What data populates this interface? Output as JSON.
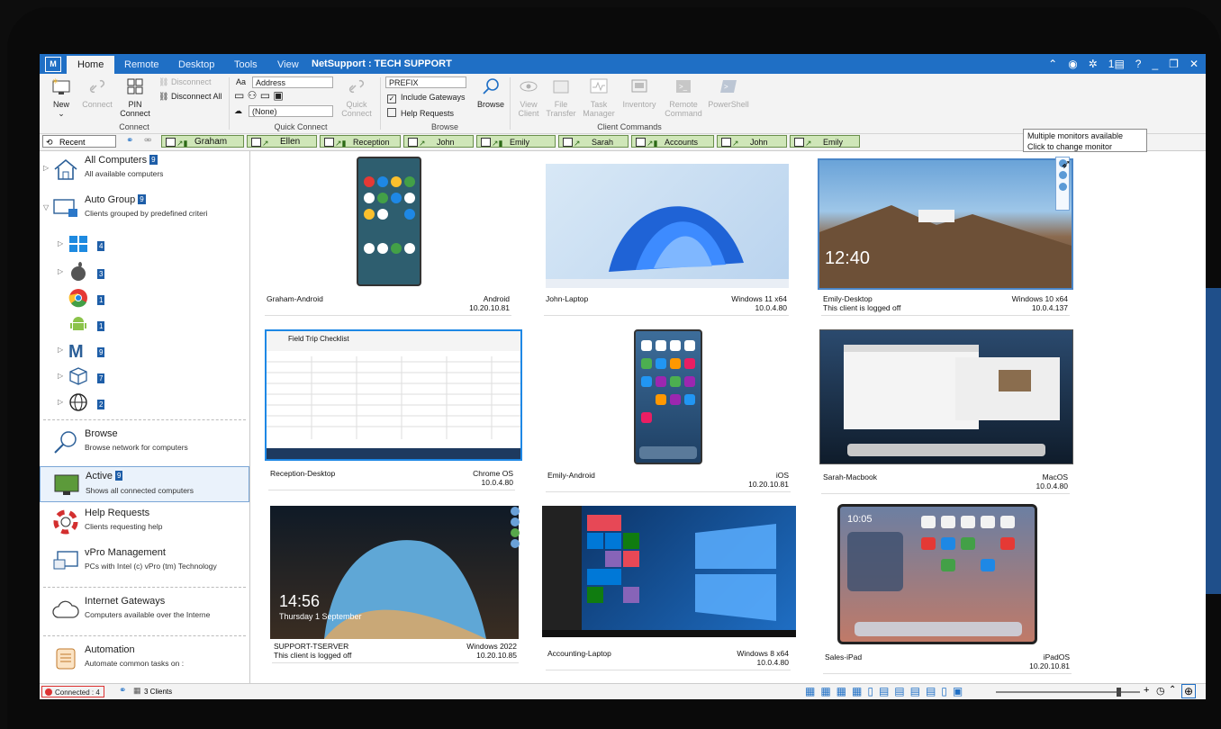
{
  "app": {
    "title": "NetSupport : TECH SUPPORT",
    "icon_label": "M"
  },
  "tabs": [
    {
      "label": "Home"
    },
    {
      "label": "Remote"
    },
    {
      "label": "Desktop"
    },
    {
      "label": "Tools"
    },
    {
      "label": "View"
    }
  ],
  "titlebar_right": {
    "notifications": "1"
  },
  "ribbon": {
    "connect_group": {
      "label": "Connect",
      "new": "New",
      "connect": "Connect",
      "pin_connect": "PIN Connect",
      "disconnect": "Disconnect",
      "disconnect_all": "Disconnect All"
    },
    "quick_connect": {
      "label": "Quick Connect",
      "address_prefix": "Aa",
      "address_placeholder": "Address",
      "none_value": "(None)",
      "quick_connect_button": "Quick Connect"
    },
    "browse_group": {
      "label": "Browse",
      "prefix_placeholder": "PREFIX",
      "include_gateways": "Include Gateways",
      "include_gateways_checked": true,
      "help_requests": "Help Requests",
      "help_requests_checked": false,
      "browse": "Browse"
    },
    "client_commands": {
      "label": "Client Commands",
      "view_client": "View Client",
      "file_transfer": "File Transfer",
      "task_manager": "Task Manager",
      "inventory": "Inventory",
      "remote_command": "Remote Command",
      "powershell": "PowerShell"
    }
  },
  "quickbar": {
    "recent": "Recent",
    "tabs": [
      "Graham",
      "Ellen",
      "Reception",
      "John",
      "Emily",
      "Sarah",
      "Accounts",
      "John",
      "Emily"
    ]
  },
  "sidebar": {
    "all_computers": {
      "title": "All Computers",
      "badge": "9",
      "subtitle": "All available computers"
    },
    "auto_group": {
      "title": "Auto Group",
      "badge": "9",
      "subtitle": "Clients grouped by predefined criteri"
    },
    "groups": [
      {
        "icon": "windows-icon",
        "count": "4"
      },
      {
        "icon": "apple-icon",
        "count": "3"
      },
      {
        "icon": "chrome-icon",
        "count": "1"
      },
      {
        "icon": "android-icon",
        "count": "1"
      },
      {
        "icon": "netsupport-icon",
        "count": "9"
      },
      {
        "icon": "cube-icon",
        "count": "7"
      },
      {
        "icon": "globe-icon",
        "count": "2"
      }
    ],
    "browse": {
      "title": "Browse",
      "subtitle": "Browse network for computers"
    },
    "active": {
      "title": "Active",
      "badge": "9",
      "subtitle": "Shows all connected computers"
    },
    "help_requests": {
      "title": "Help Requests",
      "subtitle": "Clients requesting help"
    },
    "vpro": {
      "title": "vPro Management",
      "subtitle": "PCs with Intel (c) vPro (tm) Technology"
    },
    "internet_gateways": {
      "title": "Internet Gateways",
      "subtitle": "Computers available over the Interne"
    },
    "automation": {
      "title": "Automation",
      "subtitle": "Automate common tasks on :"
    }
  },
  "clients": [
    {
      "name": "Graham-Android",
      "os": "Android",
      "ip": "10.20.10.81",
      "status": ""
    },
    {
      "name": "John-Laptop",
      "os": "Windows 11 x64",
      "ip": "10.0.4.80",
      "status": ""
    },
    {
      "name": "Emily-Desktop",
      "os": "Windows 10 x64",
      "ip": "10.0.4.137",
      "status": "This client is logged off",
      "lock_time": "12:40"
    },
    {
      "name": "Reception-Desktop",
      "os": "Chrome OS",
      "ip": "10.0.4.80",
      "status": "",
      "sheet_title": "Field Trip Checklist"
    },
    {
      "name": "Emily-Android",
      "os": "iOS",
      "ip": "10.20.10.81",
      "status": ""
    },
    {
      "name": "Sarah-Macbook",
      "os": "MacOS",
      "ip": "10.0.4.80",
      "status": ""
    },
    {
      "name": "SUPPORT-TSERVER",
      "os": "Windows 2022",
      "ip": "10.20.10.85",
      "status": "This client is logged off",
      "lock_time": "14:56",
      "lock_date": "Thursday 1 September"
    },
    {
      "name": "Accounting-Laptop",
      "os": "Windows 8 x64",
      "ip": "10.0.4.80",
      "status": ""
    },
    {
      "name": "Sales-iPad",
      "os": "iPadOS",
      "ip": "10.20.10.81",
      "status": "",
      "lock_time": "10:05"
    }
  ],
  "tooltip": {
    "line1": "Multiple monitors available",
    "line2": "Click to change monitor"
  },
  "statusbar": {
    "connected": "Connected : 4",
    "clients": "3 Clients"
  },
  "colors": {
    "accent": "#1f6fc5",
    "badge": "#1e5ea8",
    "tab_green": "#cfe6b8",
    "decor_blue": "#1e5ea8"
  }
}
